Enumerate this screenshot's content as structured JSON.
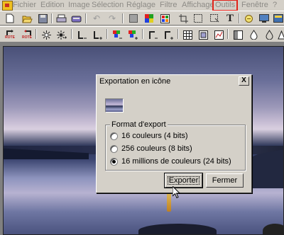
{
  "menu": {
    "items": [
      {
        "label": "Fichier"
      },
      {
        "label": "Edition"
      },
      {
        "label": "Image"
      },
      {
        "label": "Sélection"
      },
      {
        "label": "Réglage"
      },
      {
        "label": "Filtre"
      },
      {
        "label": "Affichage"
      },
      {
        "label": "Outils",
        "highlighted": true
      },
      {
        "label": "Fenêtre"
      },
      {
        "label": "?"
      }
    ]
  },
  "toolbar1": {
    "icons": [
      "new-icon",
      "open-icon",
      "save-icon",
      "print-icon",
      "scan-icon",
      "undo-icon",
      "redo-icon",
      "gray-square-icon",
      "palette-icon",
      "color-picker-icon",
      "crop-icon",
      "text-icon",
      "rotate-icon",
      "screen-icon",
      "image-icon",
      "settings-icon"
    ],
    "text_icon_glyph": "T"
  },
  "toolbar2": {
    "icons": [
      "rotate-left-icon",
      "rotate-right-icon",
      "sun-icon",
      "sun-plus-icon",
      "contrast-minus-icon",
      "contrast-plus-icon",
      "color-minus-icon",
      "color-plus-icon",
      "gamma-minus-icon",
      "gamma-plus-icon",
      "grid-icon",
      "resize-icon",
      "filter-icon",
      "levels-icon",
      "drop-icon",
      "drop-outline-icon",
      "sharpen-icon"
    ],
    "labels": {
      "rotate_left": "ROTE",
      "rotate_right": "ROTE"
    }
  },
  "dialog": {
    "title": "Exportation en icône",
    "close_label": "X",
    "group_label": "Format d'export",
    "options": [
      {
        "label": "16 couleurs (4 bits)",
        "checked": false
      },
      {
        "label": "256 couleurs (8 bits)",
        "checked": false
      },
      {
        "label": "16 millions de couleurs (24 bits)",
        "checked": true
      }
    ],
    "export_button": "Exporter",
    "close_button": "Fermer"
  },
  "colors": {
    "menu_disabled": "#8d8b86",
    "highlight_box": "#e0241b",
    "face": "#d4d0c8"
  }
}
